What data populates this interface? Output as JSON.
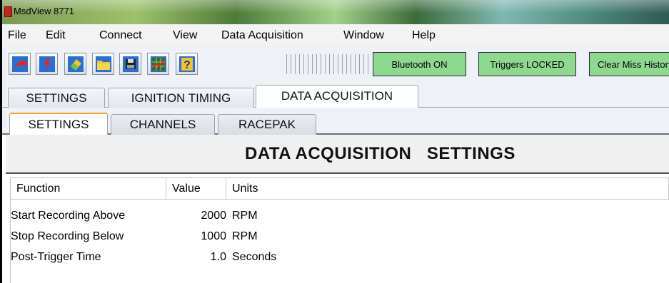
{
  "window": {
    "title": "MsdView  8771"
  },
  "menu": [
    "File",
    "Edit",
    "Connect",
    "View",
    "Data Acquisition",
    "Window",
    "Help"
  ],
  "toolbar": {
    "icons": [
      "arrow-red-icon",
      "open-folder-red-icon",
      "eraser-icon",
      "folder-icon",
      "save-icon",
      "chart-icon",
      "help-icon"
    ],
    "buttons": [
      "Bluetooth ON",
      "Triggers LOCKED",
      "Clear Miss History"
    ],
    "button_color": "#8fd88f"
  },
  "tabs": [
    "SETTINGS",
    "IGNITION TIMING",
    "DATA ACQUISITION"
  ],
  "active_tab": "DATA ACQUISITION",
  "subtabs": [
    "SETTINGS",
    "CHANNELS",
    "RACEPAK"
  ],
  "active_subtab": "SETTINGS",
  "panel": {
    "title": "DATA ACQUISITION   SETTINGS"
  },
  "table": {
    "columns": [
      "Function",
      "Value",
      "Units"
    ],
    "rows": [
      {
        "function": "Start Recording Above",
        "value": "2000",
        "units": "RPM"
      },
      {
        "function": "Stop Recording Below",
        "value": "1000",
        "units": "RPM"
      },
      {
        "function": "Post-Trigger Time",
        "value": "1.0",
        "units": "Seconds"
      }
    ]
  }
}
